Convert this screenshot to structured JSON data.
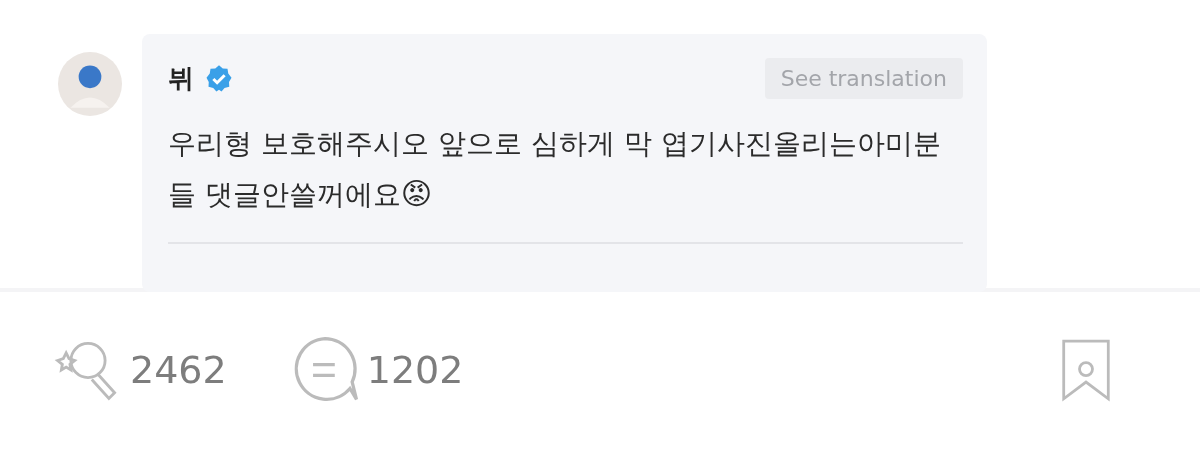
{
  "comment": {
    "author": "뷔",
    "verified": true,
    "translate_button": "See translation",
    "text": "우리형 보호해주시오 앞으로 심하게 막 엽기사진올리는아미분들 댓글안쓸꺼에요",
    "emoji": "😡"
  },
  "actions": {
    "likes": "2462",
    "comments": "1202"
  }
}
